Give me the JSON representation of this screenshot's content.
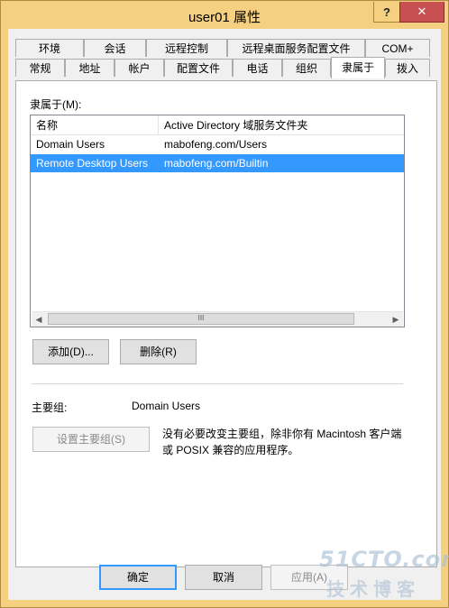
{
  "window": {
    "title": "user01 属性",
    "help_label": "?",
    "close_label": "✕"
  },
  "tabs": {
    "row_back": [
      "环境",
      "会话",
      "远程控制",
      "远程桌面服务配置文件",
      "COM+"
    ],
    "row_front": [
      "常规",
      "地址",
      "帐户",
      "配置文件",
      "电话",
      "组织",
      "隶属于",
      "拨入"
    ],
    "active": "隶属于"
  },
  "member_of": {
    "label": "隶属于(M):",
    "columns": [
      "名称",
      "Active Directory 域服务文件夹"
    ],
    "rows": [
      {
        "name": "Domain Users",
        "folder": "mabofeng.com/Users",
        "selected": false
      },
      {
        "name": "Remote Desktop Users",
        "folder": "mabofeng.com/Builtin",
        "selected": true
      }
    ],
    "scroll_left": "◀",
    "scroll_right": "▶",
    "scroll_thumb_grip": "III"
  },
  "buttons": {
    "add": "添加(D)...",
    "remove": "删除(R)",
    "set_primary": "设置主要组(S)",
    "ok": "确定",
    "cancel": "取消",
    "apply": "应用(A)"
  },
  "primary_group": {
    "label": "主要组:",
    "value": "Domain Users",
    "note": "没有必要改变主要组，除非你有 Macintosh 客户端或 POSIX 兼容的应用程序。"
  },
  "watermark": {
    "logo": "51CTO.com",
    "sub": "技术博客"
  }
}
